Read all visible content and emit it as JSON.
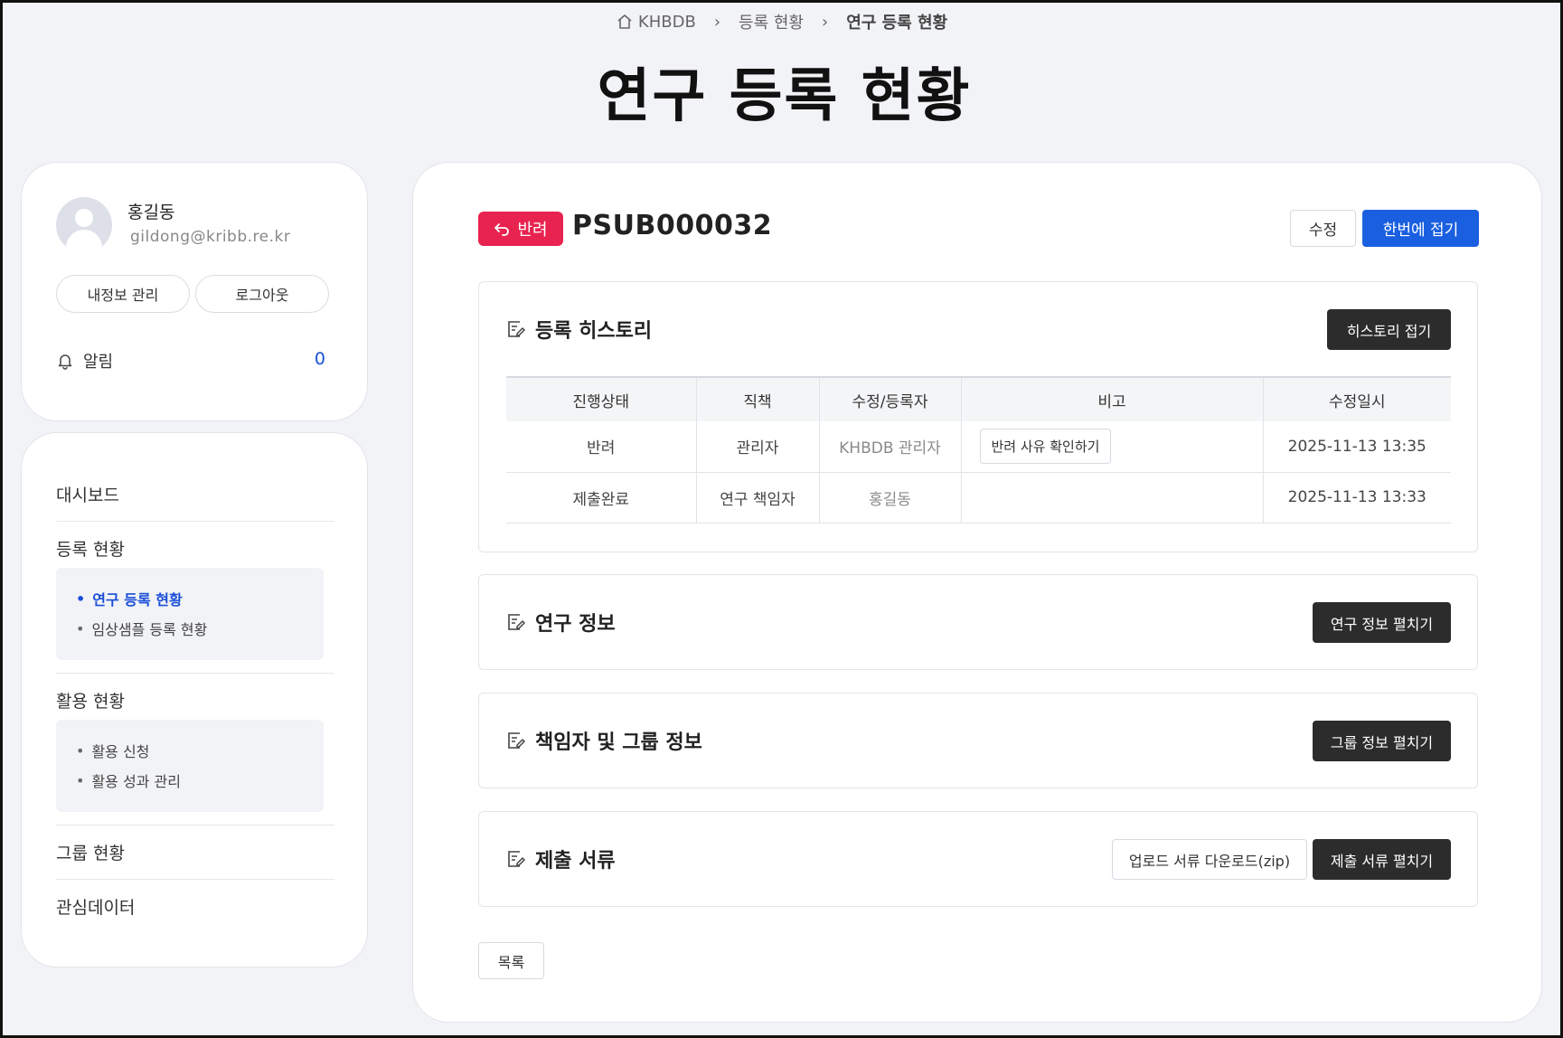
{
  "breadcrumb": {
    "home": "KHBDB",
    "sep": "›",
    "level2": "등록 현황",
    "current": "연구 등록 현황"
  },
  "page_title": "연구 등록 현황",
  "profile": {
    "name": "홍길동",
    "email": "gildong@kribb.re.kr",
    "my_info_button": "내정보 관리",
    "logout_button": "로그아웃",
    "alarm_label": "알림",
    "alarm_count": "0"
  },
  "nav": {
    "dashboard": "대시보드",
    "registration": {
      "label": "등록 현황",
      "items": [
        "연구 등록 현황",
        "임상샘플 등록 현황"
      ]
    },
    "usage": {
      "label": "활용 현황",
      "items": [
        "활용 신청",
        "활용 성과 관리"
      ]
    },
    "group": "그룹 현황",
    "interest": "관심데이터"
  },
  "record": {
    "status": "반려",
    "id": "PSUB000032",
    "edit_button": "수정",
    "collapse_all_button": "한번에 접기"
  },
  "history": {
    "title": "등록 히스토리",
    "toggle_button": "히스토리 접기",
    "columns": [
      "진행상태",
      "직책",
      "수정/등록자",
      "비고",
      "수정일시"
    ],
    "rows": [
      {
        "status": "반려",
        "role": "관리자",
        "editor": "KHBDB 관리자",
        "note_button": "반려 사유 확인하기",
        "date": "2025-11-13 13:35"
      },
      {
        "status": "제출완료",
        "role": "연구 책임자",
        "editor": "홍길동",
        "note_button": "",
        "date": "2025-11-13 13:33"
      }
    ]
  },
  "research_info": {
    "title": "연구 정보",
    "toggle_button": "연구 정보 펼치기"
  },
  "group_info": {
    "title": "책임자 및 그룹 정보",
    "toggle_button": "그룹 정보 펼치기"
  },
  "documents": {
    "title": "제출 서류",
    "download_button": "업로드 서류 다운로드(zip)",
    "toggle_button": "제출 서류 펼치기"
  },
  "list_button": "목록",
  "colors": {
    "accent_blue": "#1a5fe0",
    "status_red": "#e8234f",
    "dark_button": "#2c2c2c",
    "background": "#f2f3f6"
  }
}
